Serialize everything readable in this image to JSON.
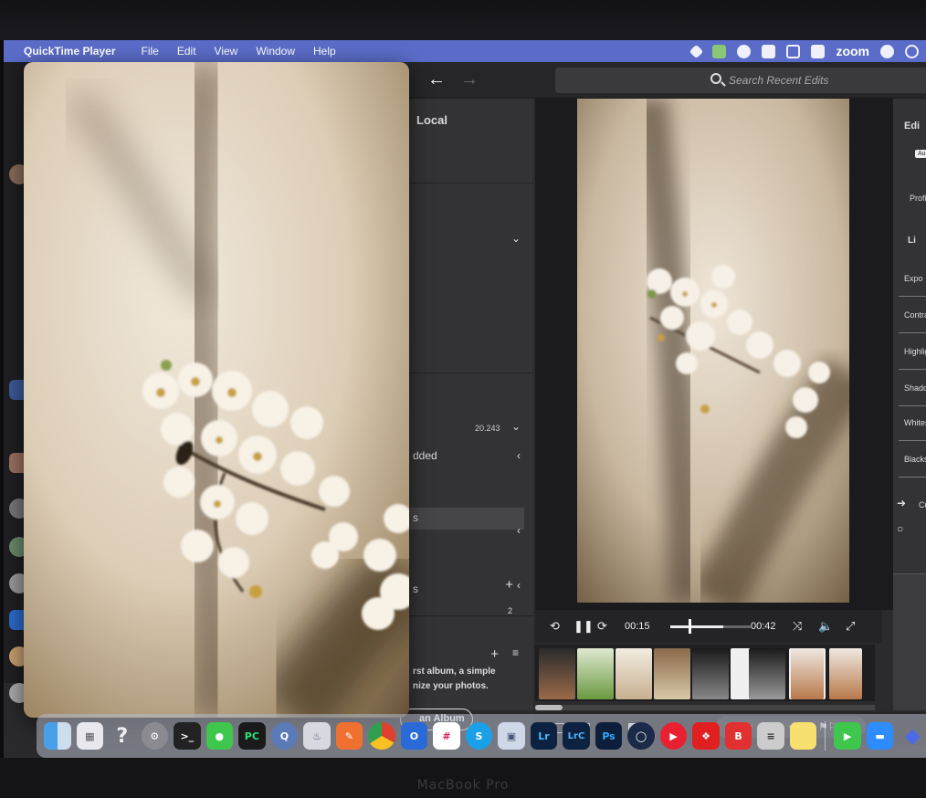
{
  "menubar": {
    "app_name": "QuickTime Player",
    "items": [
      "File",
      "Edit",
      "View",
      "Window",
      "Help"
    ],
    "zoom_label": "zoom"
  },
  "lightroom": {
    "search_placeholder": "Search Recent Edits",
    "library": {
      "local_label": "Local",
      "photo_count": "20.243",
      "row_added": "dded",
      "row_selected": "s",
      "row_albums": "s",
      "albums_count": "2",
      "promo_line1": "rst album, a simple",
      "promo_line2": "nize your photos.",
      "create_album_label": "an Album"
    },
    "player": {
      "elapsed": "00:15",
      "total": "00:42",
      "progress": 0.36
    },
    "edit_panel": {
      "title": "Edi",
      "auto_label": "Au",
      "profile_label": "Profi",
      "light_section": "Li",
      "sliders": [
        "Expo",
        "Contra",
        "Highlig",
        "Shadov",
        "Whites",
        "Blacks"
      ],
      "curve_label": "Cu"
    },
    "rating_stars": "★★★★★"
  },
  "dock": {
    "lr_label": "Lr",
    "lrc_label": "LrC",
    "ps_label": "Ps",
    "s_label": "S",
    "b_label": "B"
  },
  "device_label": "MacBook Pro",
  "colors": {
    "menubar": "#5a6cc8",
    "lightroom_bg": "#2b2b2d",
    "dock_bg": "#b4b9c8"
  }
}
